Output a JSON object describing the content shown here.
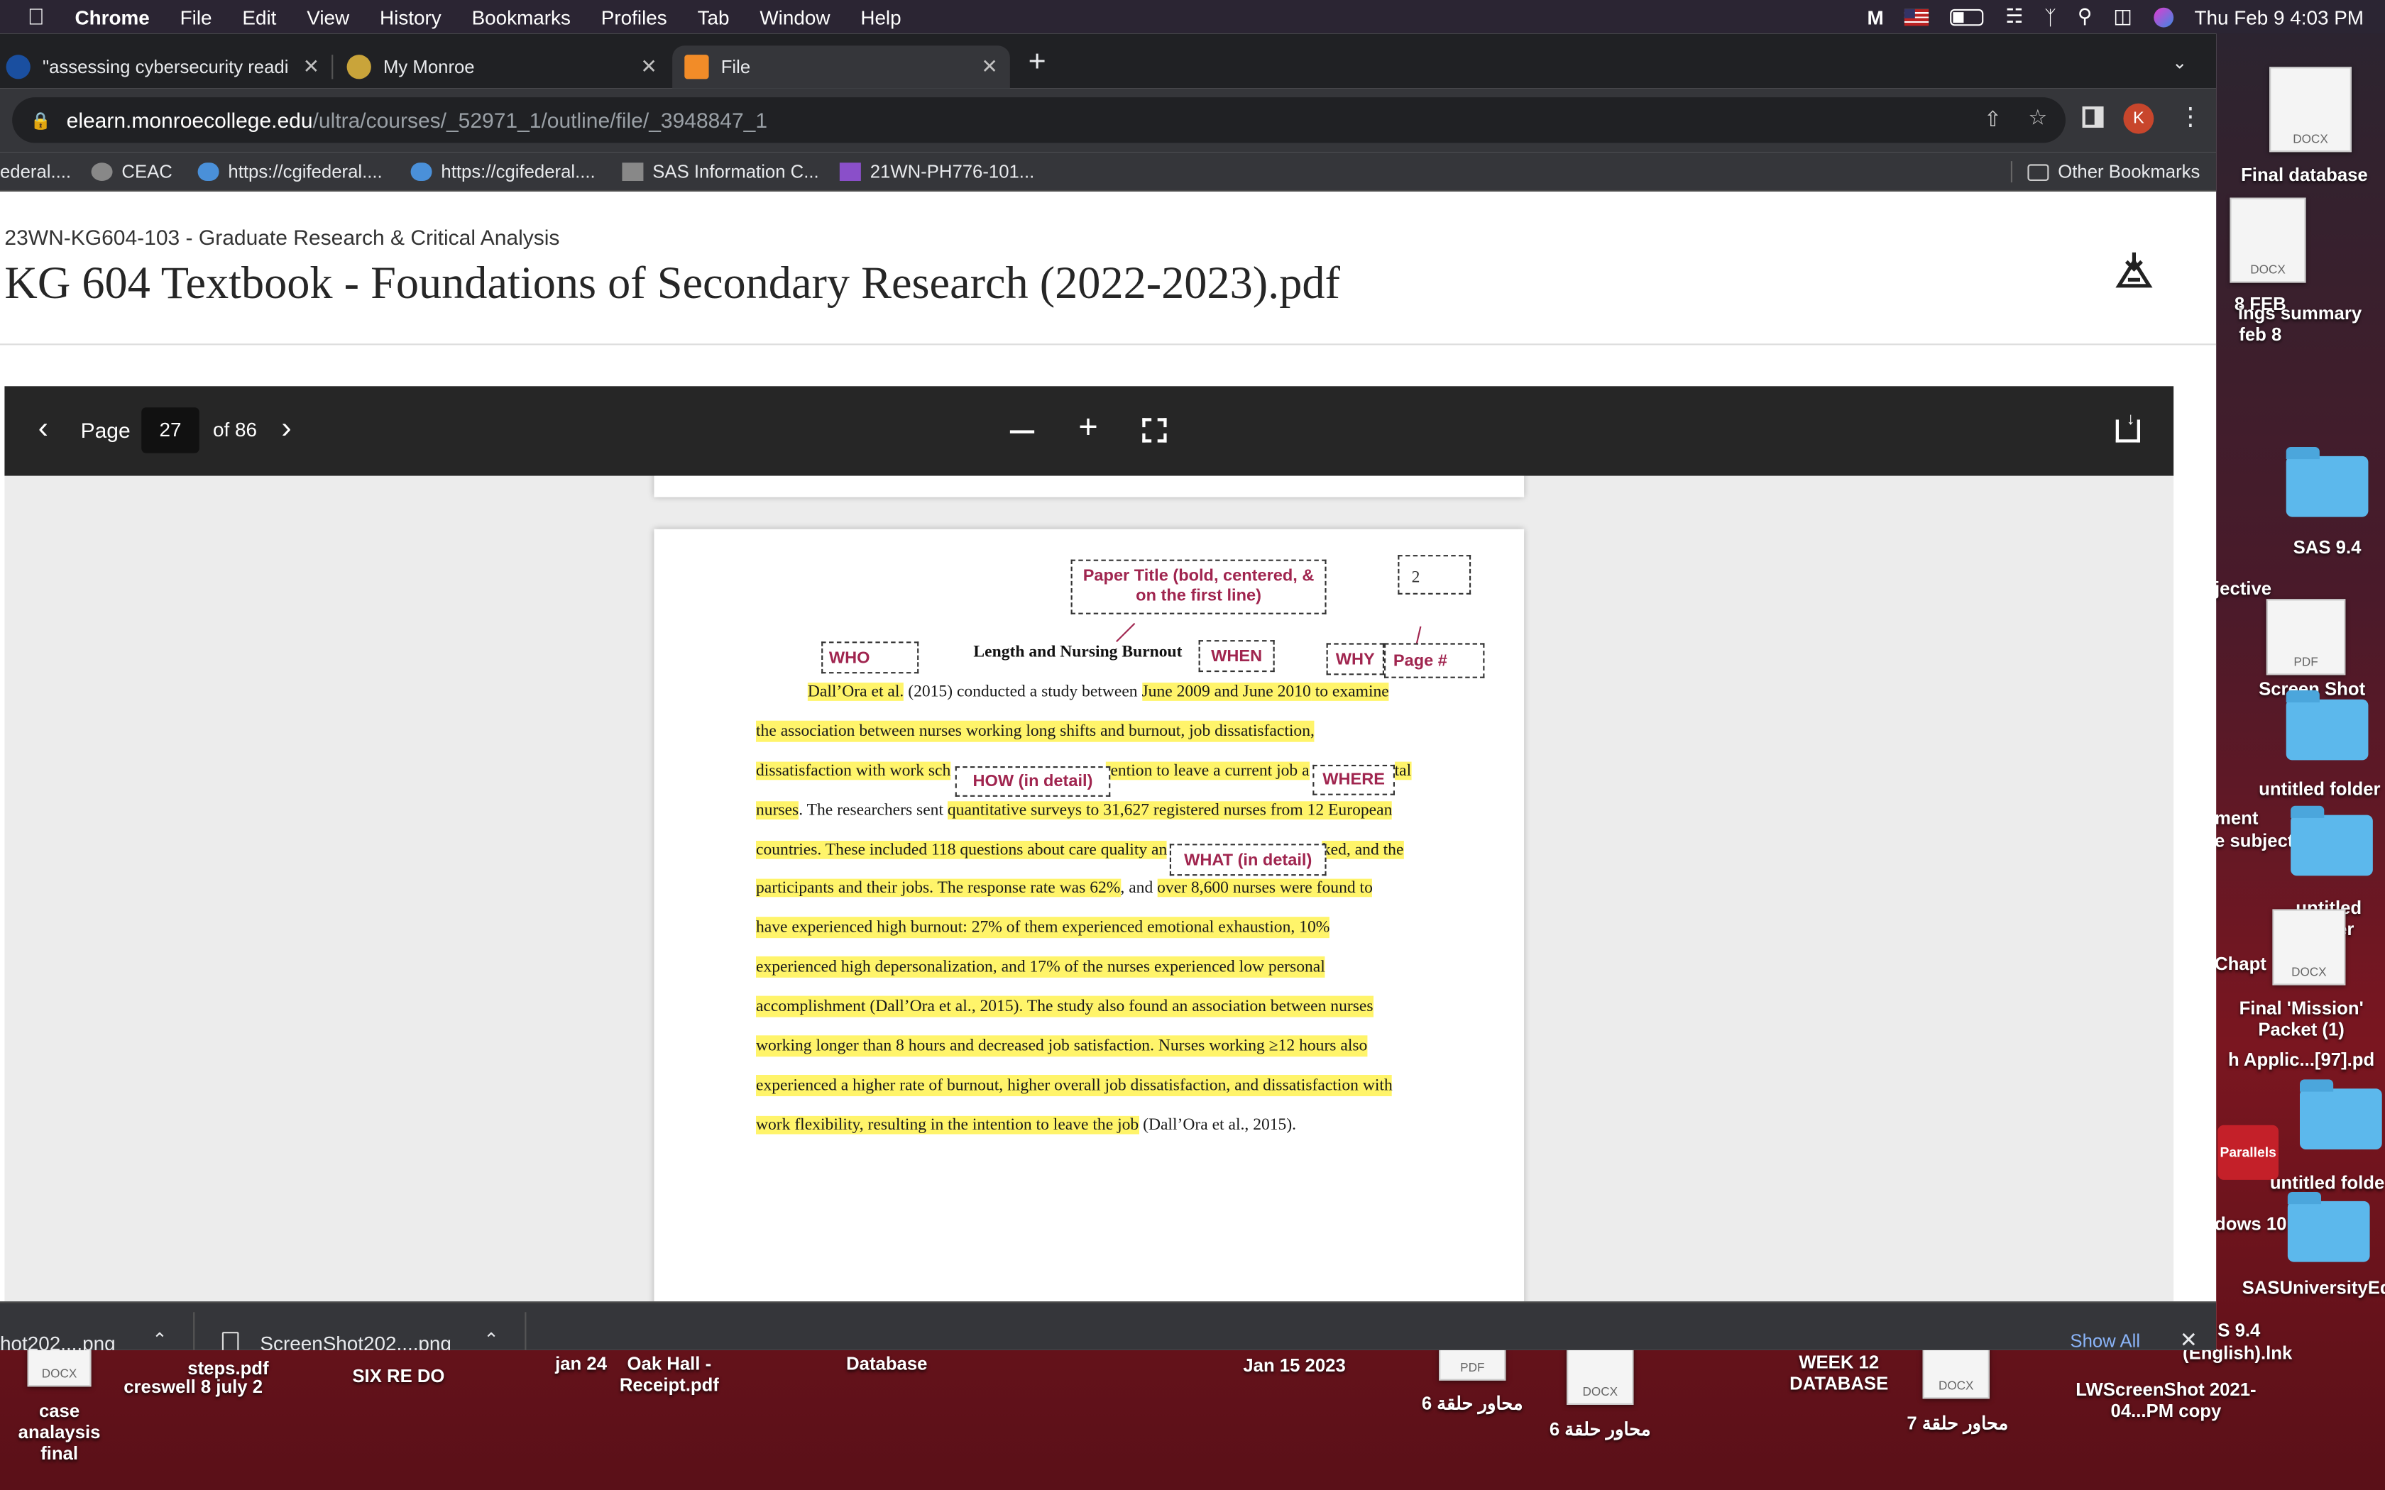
{
  "menubar": {
    "app": "Chrome",
    "items": [
      "File",
      "Edit",
      "View",
      "History",
      "Bookmarks",
      "Profiles",
      "Tab",
      "Window",
      "Help"
    ],
    "clock": "Thu Feb 9  4:03 PM"
  },
  "tabs": [
    {
      "title": "\"assessing cybersecurity readi"
    },
    {
      "title": "My Monroe"
    },
    {
      "title": "File"
    }
  ],
  "omnibox": {
    "domain": "elearn.monroecollege.edu",
    "path": "/ultra/courses/_52971_1/outline/file/_3948847_1"
  },
  "bookmarks": [
    {
      "label": "ederal...."
    },
    {
      "label": "CEAC"
    },
    {
      "label": "https://cgifederal...."
    },
    {
      "label": "https://cgifederal...."
    },
    {
      "label": "SAS Information C..."
    },
    {
      "label": "21WN-PH776-101..."
    }
  ],
  "other_bookmarks": "Other Bookmarks",
  "course": {
    "code": "23WN-KG604-103 - Graduate Research & Critical Analysis",
    "file_title": "KG 604 Textbook - Foundations of Secondary Research (2022-2023).pdf"
  },
  "pdf_toolbar": {
    "page_label": "Page",
    "page": "27",
    "of": "of 86"
  },
  "document": {
    "page_number": "2",
    "heading": "Length and Nursing Burnout",
    "annotations": {
      "paper_title": "Paper Title (bold, centered, & on the first line)",
      "who": "WHO",
      "when": "WHEN",
      "why": "WHY",
      "page_num": "Page #",
      "how": "HOW (in detail)",
      "where": "WHERE",
      "what": "WHAT (in detail)"
    },
    "lines": {
      "l1a": "Dall’Ora et al.",
      "l1b": " (2015) conducted a study between ",
      "l1c": "June 2009 and June 2010",
      "l1d": " to examine",
      "l2": "the association between nurses working long shifts and burnout, job dissatisfaction,",
      "l3a": "dissatisfaction with work sch",
      "l3b": "tention to leave a current job a",
      "l3c": "tal",
      "l4a": "nurses",
      "l4b": ". The researchers sent ",
      "l4c": "quantitative surveys to 31,627 registered nurses from 12 European",
      "l5a": "countries. These included 118 questions about care quality an",
      "l5b": "ked, and the",
      "l6a": "participants and their jobs. The response rate was 62%",
      "l6b": ", and ",
      "l6c": "over 8,600 nurses were found to",
      "l7": "have experienced high burnout: 27% of them experienced emotional exhaustion, 10%",
      "l8": "experienced high depersonalization, and 17% of the nurses experienced low personal",
      "l9": "accomplishment (Dall’Ora et al., 2015). The study also found an association between nurses",
      "l10": "working longer than 8 hours and decreased job satisfaction. Nurses working ≥12 hours also",
      "l11": "experienced a higher rate of burnout, higher overall job dissatisfaction, and dissatisfaction with",
      "l12a": "work flexibility, resulting in the intention to leave the job",
      "l12b": " (Dall’Ora et al., 2015)."
    }
  },
  "downloads": {
    "item1": "hot202....png",
    "item2": "ScreenShot202....png",
    "show_all": "Show All"
  },
  "desktop": {
    "right_labels": {
      "r1": "8 FEB",
      "r2": "ings summary",
      "r3": "feb 8",
      "r4": "SAS 9.4",
      "r5": "jective",
      "r6": "Screen Shot",
      "r7": "untitled folder",
      "r8": "ment",
      "r9": "e subject",
      "r10": "untitled folder",
      "r11": "Chapt",
      "r12": "Final 'Mission' Packet (1)",
      "r13": "h Applic...[97].pd",
      "r14": "Parallels",
      "r15": "dows 10",
      "r16": "untitled folde",
      "r17": "SASUniversityEdition",
      "r18": "S 9.4",
      "r19": "(English).lnk",
      "r20": "Final database"
    },
    "bottom_labels": {
      "b1": "case analaysis final",
      "b2": "creswell 8 july 2",
      "b3": "SIX RE DO",
      "b4": "jan 24",
      "b5": "Oak Hall - Receipt.pdf",
      "b6": "Database",
      "b7": "Jan 15 2023",
      "b8": "محاور حلقة 6",
      "b9": "محاور حلقة 6",
      "b10": "WEEK 12 DATABASE",
      "b11": "محاور حلقة 7",
      "b12": "LWScreenShot 2021-04...PM copy",
      "b13": "steps.pdf"
    }
  }
}
